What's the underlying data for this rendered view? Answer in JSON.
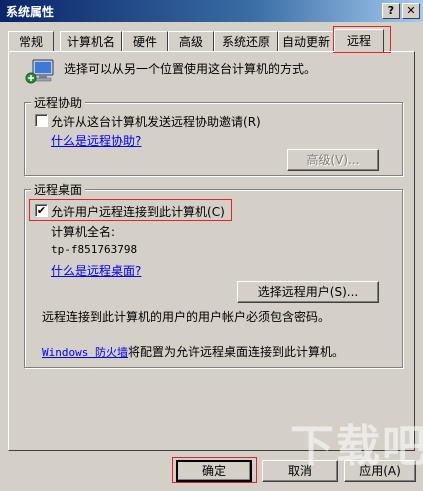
{
  "window": {
    "title": "系统属性"
  },
  "titlebar_buttons": {
    "help": "?",
    "close": "✕"
  },
  "tabs": [
    {
      "label": "常规"
    },
    {
      "label": "计算机名"
    },
    {
      "label": "硬件"
    },
    {
      "label": "高级"
    },
    {
      "label": "系统还原"
    },
    {
      "label": "自动更新"
    },
    {
      "label": "远程",
      "active": true
    }
  ],
  "intro": {
    "text": "选择可以从另一个位置使用这台计算机的方式。"
  },
  "remote_assistance": {
    "group_label": "远程协助",
    "checkbox_label": "允许从这台计算机发送远程协助邀请",
    "checkbox_mnemonic": "(R)",
    "checked": false,
    "link_text": "什么是远程协助?",
    "advanced_button": "高级(V)..."
  },
  "remote_desktop": {
    "group_label": "远程桌面",
    "checkbox_label": "允许用户远程连接到此计算机",
    "checkbox_mnemonic": "(C)",
    "checked": true,
    "computer_name_label": "计算机全名:",
    "computer_name": "tp-f851763798",
    "link_text": "什么是远程桌面?",
    "select_users_button": "选择远程用户(S)...",
    "password_note": "远程连接到此计算机的用户的用户帐户必须包含密码。",
    "firewall_link": "Windows 防火墙",
    "firewall_text": "将配置为允许远程桌面连接到此计算机。"
  },
  "footer": {
    "ok": "确定",
    "cancel": "取消",
    "apply": "应用(A)"
  },
  "watermark": "下载吧",
  "colors": {
    "highlight": "#e0242c",
    "link": "#0000ee",
    "face": "#d4d0c8"
  }
}
